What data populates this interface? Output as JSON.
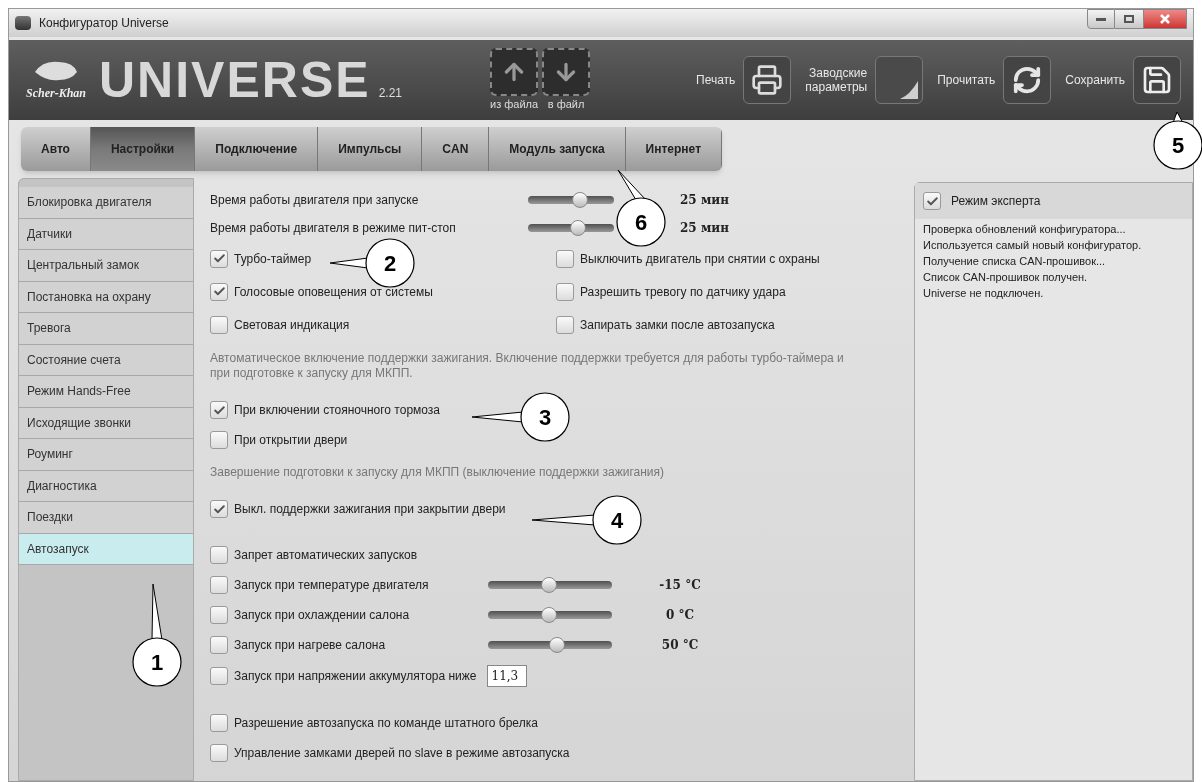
{
  "window": {
    "title": "Конфигуратор Universe"
  },
  "header": {
    "brand": "Scher-Khan",
    "product": "UNIVERSE",
    "version": "2.21",
    "tools": [
      {
        "kind": "load",
        "label": "из файла"
      },
      {
        "kind": "store",
        "label": "в файл"
      },
      {
        "kind": "print",
        "label": "Печать"
      },
      {
        "kind": "factory",
        "label": "Заводские параметры"
      },
      {
        "kind": "read",
        "label": "Прочитать"
      },
      {
        "kind": "save",
        "label": "Сохранить"
      }
    ]
  },
  "tabs": [
    {
      "label": "Авто",
      "selected": false
    },
    {
      "label": "Настройки",
      "selected": true
    },
    {
      "label": "Подключение",
      "selected": false
    },
    {
      "label": "Импульсы",
      "selected": false
    },
    {
      "label": "CAN",
      "selected": false
    },
    {
      "label": "Модуль запуска",
      "selected": false
    },
    {
      "label": "Интернет",
      "selected": false
    }
  ],
  "sidebar": {
    "items": [
      {
        "label": "Блокировка двигателя",
        "selected": false
      },
      {
        "label": "Датчики",
        "selected": false
      },
      {
        "label": "Центральный замок",
        "selected": false
      },
      {
        "label": "Постановка на охрану",
        "selected": false
      },
      {
        "label": "Тревога",
        "selected": false
      },
      {
        "label": "Состояние счета",
        "selected": false
      },
      {
        "label": "Режим Hands-Free",
        "selected": false
      },
      {
        "label": "Исходящие звонки",
        "selected": false
      },
      {
        "label": "Роуминг",
        "selected": false
      },
      {
        "label": "Диагностика",
        "selected": false
      },
      {
        "label": "Поездки",
        "selected": false
      },
      {
        "label": "Автозапуск",
        "selected": true
      }
    ]
  },
  "settings": [
    {
      "kind": "slider",
      "label": "Время работы двигателя при запуске",
      "level": 0.6,
      "reading": "25 мин"
    },
    {
      "kind": "slider",
      "label": "Время работы двигателя в режиме пит-стоп",
      "level": 0.58,
      "reading": "25 мин"
    },
    {
      "kind": "pair",
      "left": {
        "label": "Турбо-таймер",
        "checked": true
      },
      "right": {
        "label": "Выключить двигатель при снятии с охраны",
        "checked": false
      }
    },
    {
      "kind": "pair",
      "left": {
        "label": "Голосовые оповещения от системы",
        "checked": true
      },
      "right": {
        "label": "Разрешить тревогу по датчику удара",
        "checked": false
      }
    },
    {
      "kind": "pair",
      "left": {
        "label": "Световая индикация",
        "checked": false
      },
      "right": {
        "label": "Запирать замки после автозапуска",
        "checked": false
      }
    },
    {
      "kind": "note",
      "text": "Автоматическое включение поддержки зажигания. Включение поддержки требуется для работы турбо-таймера и при подготовке к запуску для МКПП."
    },
    {
      "kind": "check",
      "label": "При включении стояночного тормоза",
      "checked": true
    },
    {
      "kind": "check",
      "label": "При открытии двери",
      "checked": false
    },
    {
      "kind": "note",
      "text": "Завершение подготовки к запуску для МКПП (выключение поддержки зажигания)"
    },
    {
      "kind": "check",
      "label": "Выкл. поддержки зажигания при закрытии двери",
      "checked": true
    },
    {
      "kind": "gap"
    },
    {
      "kind": "check",
      "label": "Запрет автоматических запусков",
      "checked": false
    },
    {
      "kind": "check_slider",
      "label": "Запуск при температуре двигателя",
      "checked": false,
      "level": 0.49,
      "reading": "-15 °C"
    },
    {
      "kind": "check_slider",
      "label": "Запуск при охлаждении салона",
      "checked": false,
      "level": 0.49,
      "reading": "0 °C"
    },
    {
      "kind": "check_slider",
      "label": "Запуск при нагреве салона",
      "checked": false,
      "level": 0.56,
      "reading": "50 °C"
    },
    {
      "kind": "check_input",
      "label": "Запуск при напряжении аккумулятора ниже",
      "checked": false,
      "value": "11,3"
    },
    {
      "kind": "gap"
    },
    {
      "kind": "check",
      "label": "Разрешение автозапуска по команде штатного брелка",
      "checked": false
    },
    {
      "kind": "check",
      "label": "Управление замками дверей по slave в режиме автозапуска",
      "checked": false
    }
  ],
  "expert_panel": {
    "label": "Режим эксперта",
    "checked": true,
    "log": [
      "Проверка обновлений конфигуратора...",
      "Используется самый новый конфигуратор.",
      "Получение списка CAN-прошивок...",
      "Список CAN-прошивок получен.",
      "Universe не подключен."
    ]
  },
  "callouts": [
    {
      "label": "1"
    },
    {
      "label": "2"
    },
    {
      "label": "3"
    },
    {
      "label": "4"
    },
    {
      "label": "5"
    },
    {
      "label": "6"
    }
  ]
}
